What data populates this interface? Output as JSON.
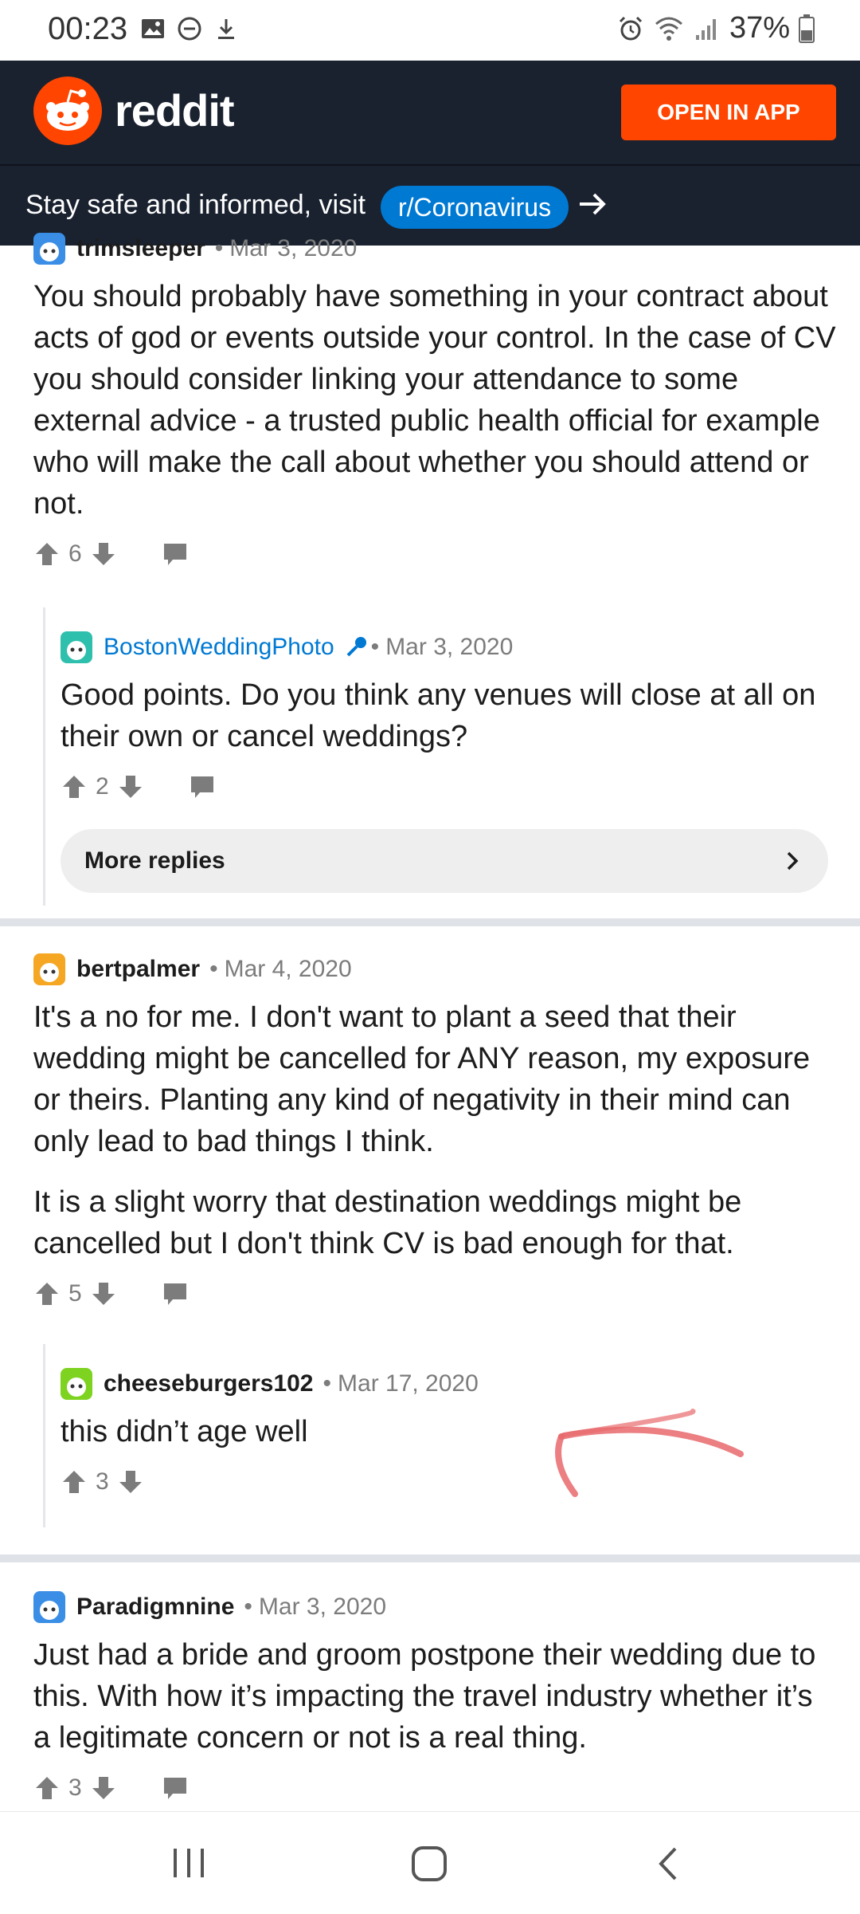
{
  "status_bar": {
    "time": "00:23",
    "battery": "37%"
  },
  "header": {
    "logo_text": "reddit",
    "open_app_label": "OPEN IN APP"
  },
  "banner": {
    "text": "Stay safe and informed, visit",
    "link": "r/Coronavirus"
  },
  "comments": [
    {
      "user": "trimsleeper",
      "date": "Mar 3, 2020",
      "text": "You should probably have something in your contract about acts of god or events outside your control. In the case of CV you should consider linking your attendance to some external advice - a trusted public health official for example who will make the call about whether you should attend or not.",
      "score": "6"
    },
    {
      "user": "BostonWeddingPhoto",
      "date": "Mar 3, 2020",
      "text": "Good points. Do you think any venues will close at all on their own or cancel weddings?",
      "score": "2"
    },
    {
      "user": "bertpalmer",
      "date": "Mar 4, 2020",
      "paragraphs": [
        "It's a no for me. I don't want to plant a seed that their wedding might be cancelled for ANY reason, my exposure or theirs. Planting any kind of negativity in their mind can only lead to bad things I think.",
        "It is a slight worry that destination weddings might be cancelled but I don't think CV is bad enough for that."
      ],
      "score": "5"
    },
    {
      "user": "cheeseburgers102",
      "date": "Mar 17, 2020",
      "text": "this didn’t age well",
      "score": "3"
    },
    {
      "user": "Paradigmnine",
      "date": "Mar 3, 2020",
      "text": "Just had a bride and groom postpone their wedding due to this. With how it’s impacting the travel industry whether it’s a legitimate concern or not is a real thing.",
      "score": "3"
    }
  ],
  "more_replies_label": "More replies",
  "colors": {
    "accent": "#ff4500",
    "header_bg": "#1a2230",
    "link_blue": "#0079d3",
    "annotation_red": "#e8696c"
  }
}
